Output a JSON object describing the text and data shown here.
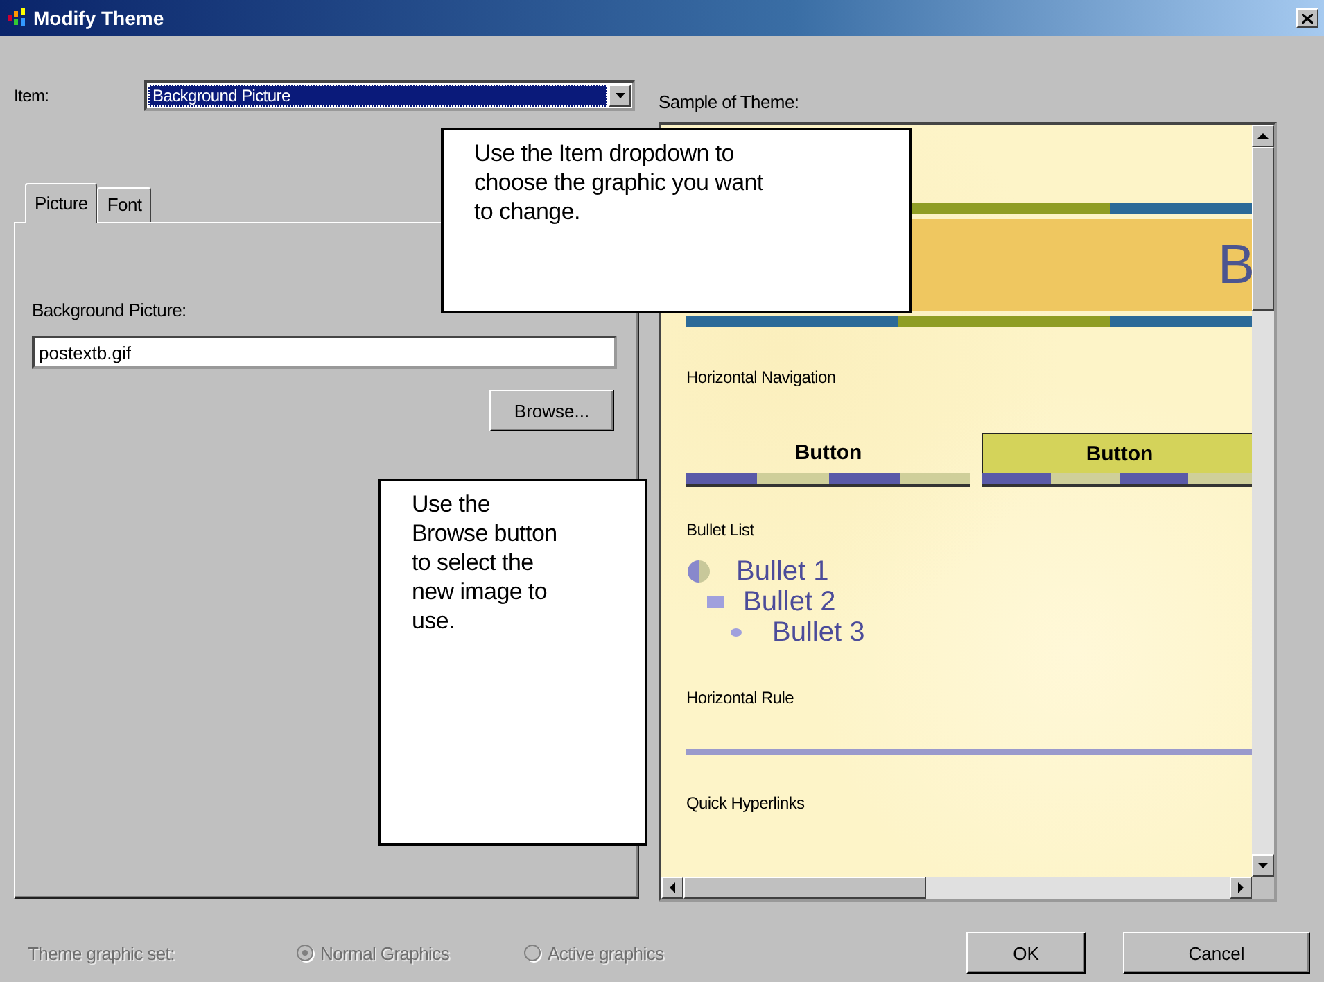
{
  "window": {
    "title": "Modify Theme"
  },
  "item": {
    "label": "Item:",
    "value": "Background Picture"
  },
  "sample_label": "Sample of Theme:",
  "tabs": [
    {
      "label": "Picture",
      "selected": true
    },
    {
      "label": "Font",
      "selected": false
    }
  ],
  "picture_tab": {
    "field_label": "Background Picture:",
    "value": "postextb.gif",
    "browse_button": "Browse..."
  },
  "sample": [
    {
      "kind": "banner",
      "text": "B"
    },
    {
      "kind": "heading",
      "text": "Horizontal Navigation"
    },
    {
      "kind": "nav",
      "buttons": [
        {
          "label": "Button",
          "active": false
        },
        {
          "label": "Button",
          "active": true
        }
      ]
    },
    {
      "kind": "heading",
      "text": "Bullet List"
    },
    {
      "kind": "bullets",
      "items": [
        {
          "label": "Bullet 1",
          "children": [
            {
              "label": "Bullet 2",
              "children": [
                {
                  "label": "Bullet 3"
                }
              ]
            }
          ]
        }
      ]
    },
    {
      "kind": "heading",
      "text": "Horizontal Rule"
    },
    {
      "kind": "rule"
    },
    {
      "kind": "heading",
      "text": "Quick Hyperlinks"
    }
  ],
  "graphic_set": {
    "label": "Theme graphic set:",
    "disabled": true,
    "options": [
      {
        "label": "Normal Graphics",
        "selected": true
      },
      {
        "label": "Active graphics",
        "selected": false
      }
    ]
  },
  "buttons": [
    "OK",
    "Cancel"
  ],
  "callouts": [
    {
      "text": "Use the Item dropdown to choose the graphic you want to change."
    },
    {
      "text": "Use the Browse button to select the new image to use."
    }
  ]
}
